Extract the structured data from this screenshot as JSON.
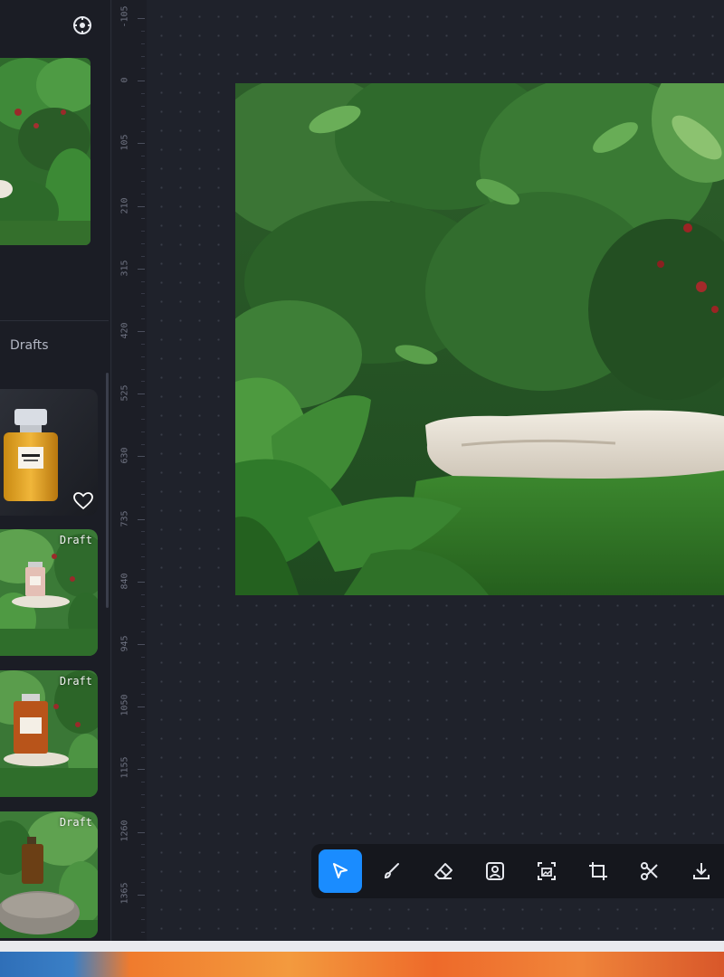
{
  "left_panel": {
    "drafts_label": "Drafts",
    "drafts": [
      {
        "badge": "",
        "kind": "bottle-gold",
        "favorite": true
      },
      {
        "badge": "Draft",
        "kind": "scene-pink"
      },
      {
        "badge": "Draft",
        "kind": "scene-amber"
      },
      {
        "badge": "Draft",
        "kind": "scene-rock"
      }
    ]
  },
  "ruler": {
    "labels": [
      "-105",
      "0",
      "105",
      "210",
      "315",
      "420",
      "525",
      "630",
      "735",
      "840",
      "945",
      "1050",
      "1155",
      "1260",
      "1365"
    ]
  },
  "toolbar": {
    "tools": [
      "select-arrow-icon",
      "brush-icon",
      "eraser-icon",
      "portrait-icon",
      "image-expand-icon",
      "crop-icon",
      "scissors-icon",
      "download-icon"
    ],
    "active_tool": "select-arrow-icon"
  },
  "colors": {
    "accent": "#1a8cff",
    "background": "#1e2029",
    "toolbar": "#15171d"
  }
}
